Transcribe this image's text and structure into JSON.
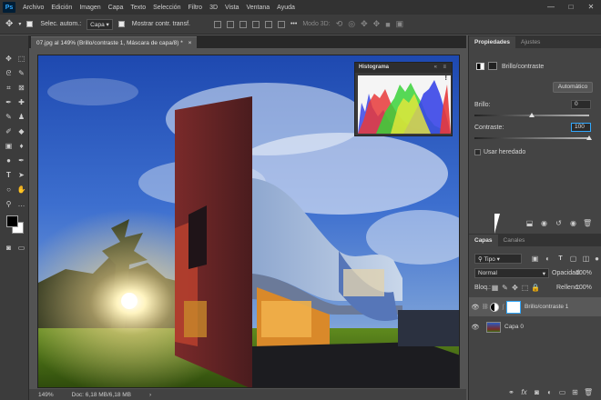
{
  "app": {
    "logo_text": "Ps"
  },
  "menu": [
    "Archivo",
    "Edición",
    "Imagen",
    "Capa",
    "Texto",
    "Selección",
    "Filtro",
    "3D",
    "Vista",
    "Ventana",
    "Ayuda"
  ],
  "window_controls": {
    "minimize": "—",
    "maximize": "□",
    "close": "✕"
  },
  "options": {
    "auto_select_label": "Selec. autom.:",
    "auto_select_value": "Capa",
    "show_transform_label": "Mostrar contr. transf.",
    "mode3d_label": "Modo 3D:",
    "more": "•••"
  },
  "document": {
    "tab_title": "07.jpg al 149% (Brillo/contraste 1, Máscara de capa/8) *",
    "close": "×"
  },
  "status": {
    "zoom": "149%",
    "doc_info": "Doc: 6,18 MB/6,18 MB"
  },
  "histogram": {
    "title": "Histograma",
    "menu": "≡",
    "collapse": "«",
    "warning": "!"
  },
  "properties": {
    "tabs": [
      "Propiedades",
      "Ajustes"
    ],
    "adjustment_name": "Brillo/contraste",
    "auto_button": "Automático",
    "brightness_label": "Brillo:",
    "brightness_value": "0",
    "brightness_fraction": 0.5,
    "contrast_label": "Contraste:",
    "contrast_value": "100",
    "contrast_fraction": 1.0,
    "legacy_label": "Usar heredado"
  },
  "layers": {
    "tabs": [
      "Capas",
      "Canales"
    ],
    "filter_value": "Tipo",
    "blend_mode": "Normal",
    "opacity_label": "Opacidad:",
    "opacity_value": "100%",
    "lock_label": "Bloq.:",
    "fill_label": "Relleno:",
    "fill_value": "100%",
    "items": [
      {
        "name": "Brillo/contraste 1",
        "selected": true
      },
      {
        "name": "Capa 0",
        "selected": false
      }
    ]
  },
  "colors": {
    "accent": "#31a8ff",
    "panel": "#444444",
    "canvas_bg": "#535353"
  }
}
